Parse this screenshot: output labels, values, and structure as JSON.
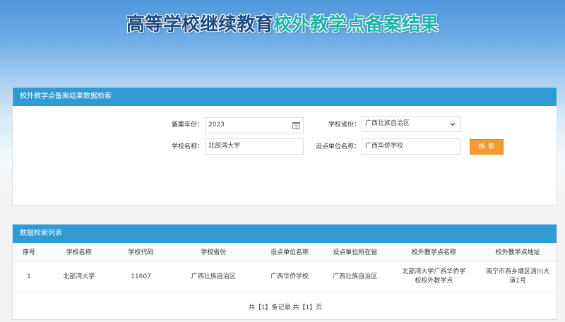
{
  "header": {
    "title_part1": "高等学校继续教育",
    "title_part2": "校外教学点备案结果"
  },
  "search_panel": {
    "title": "校外教学点备案结果数据检索",
    "year_label": "备案年份：",
    "year_value": "2023",
    "province_label": "学校省份：",
    "province_value": "广西壮族自治区",
    "school_label": "学校名称：",
    "school_value": "北部湾大学",
    "unit_label": "设点单位名称：",
    "unit_value": "广西华侨学校",
    "search_button": "搜索"
  },
  "list_panel": {
    "title": "数据检索列表",
    "columns": [
      "序号",
      "学校名称",
      "学校代码",
      "学校省份",
      "设点单位名称",
      "设点单位所在省",
      "校外教学点名称",
      "校外教学点地址"
    ],
    "rows": [
      {
        "index": "1",
        "school_name": "北部湾大学",
        "school_code": "11607",
        "school_province": "广西壮族自治区",
        "unit_name": "广西华侨学校",
        "unit_province": "广西壮族自治区",
        "site_name_l1": "北部湾大学广西华侨学",
        "site_name_l2": "校校外教学点",
        "site_addr_l1": "南宁市西乡塘区清川大",
        "site_addr_l2": "道1号"
      }
    ],
    "pager": "共【1】条记录 共【1】页"
  },
  "colors": {
    "header_bar": "#2f9ad3",
    "search_button": "#f49a2e",
    "title_dark": "#1c4a7f",
    "title_teal": "#1eb3a8"
  },
  "icons": [
    "calendar-icon",
    "chevron-down-icon"
  ]
}
